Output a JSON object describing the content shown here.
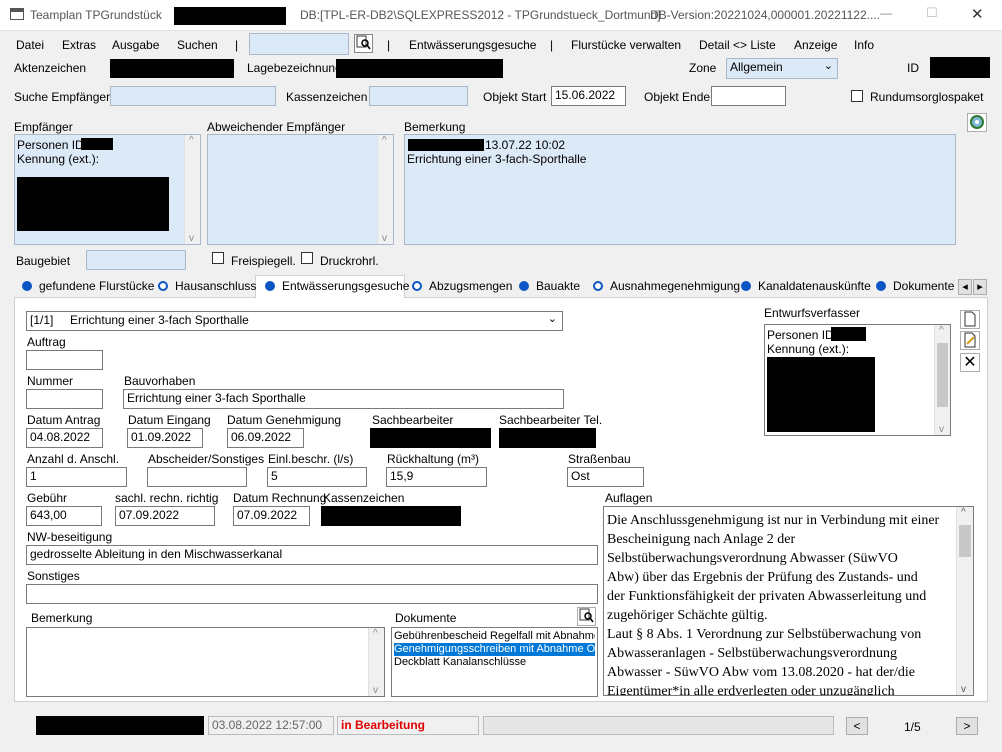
{
  "window": {
    "title": "Teamplan TPGrundstück",
    "db": "DB:[TPL-ER-DB2\\SQLEXPRESS2012 - TPGrundstueck_Dortmund]",
    "db_version": "DB-Version:20221024,000001.20221122....",
    "minimize": "—",
    "maximize": "☐",
    "close": "✕"
  },
  "menu": {
    "datei": "Datei",
    "extras": "Extras",
    "ausgabe": "Ausgabe",
    "suchen": "Suchen",
    "sep": "|",
    "entwaesserung": "Entwässerungsgesuche",
    "flurstuecke": "Flurstücke verwalten",
    "detail": "Detail <> Liste",
    "anzeige": "Anzeige",
    "info": "Info"
  },
  "header": {
    "aktenzeichen_label": "Aktenzeichen",
    "lagebezeichnung_label": "Lagebezeichnung",
    "zone_label": "Zone",
    "zone_value": "Allgemein",
    "id_label": "ID",
    "suche_empfaenger_label": "Suche Empfänger",
    "kassenzeichen_label": "Kassenzeichen",
    "objekt_start_label": "Objekt Start",
    "objekt_start_value": "15.06.2022",
    "objekt_ende_label": "Objekt Ende",
    "rundum_label": "Rundumsorglospaket"
  },
  "empfaenger": {
    "label": "Empfänger",
    "personen_id": "Personen ID:",
    "kennung": "Kennung (ext.):"
  },
  "abweichender_label": "Abweichender Empfänger",
  "bemerkung_top": {
    "label": "Bemerkung",
    "timestamp": "13.07.22 10:02",
    "text": "Errichtung einer 3-fach-Sporthalle"
  },
  "baugebiet_label": "Baugebiet",
  "freispiegel_label": "Freispiegell.",
  "druckrohr_label": "Druckrohrl.",
  "tabs": [
    {
      "label": "gefundene Flurstücke",
      "style": "filled"
    },
    {
      "label": "Hausanschluss",
      "style": "ring"
    },
    {
      "label": "Entwässerungsgesuche",
      "style": "filled"
    },
    {
      "label": "Abzugsmengen",
      "style": "ring"
    },
    {
      "label": "Bauakte",
      "style": "filled"
    },
    {
      "label": "Ausnahmegenehmigung",
      "style": "ring"
    },
    {
      "label": "Kanaldatenauskünfte",
      "style": "filled"
    },
    {
      "label": "Dokumente",
      "style": "filled"
    }
  ],
  "gesuch": {
    "selector": "[1/1]     Errichtung einer 3-fach Sporthalle",
    "auftrag_label": "Auftrag",
    "nummer_label": "Nummer",
    "bauvorhaben_label": "Bauvorhaben",
    "bauvorhaben_value": "Errichtung einer 3-fach Sporthalle",
    "datum_antrag_label": "Datum Antrag",
    "datum_antrag_value": "04.08.2022",
    "datum_eingang_label": "Datum Eingang",
    "datum_eingang_value": "01.09.2022",
    "datum_genehmigung_label": "Datum Genehmigung",
    "datum_genehmigung_value": "06.09.2022",
    "sachbearbeiter_label": "Sachbearbeiter",
    "sachbearbeiter_tel_label": "Sachbearbeiter Tel.",
    "anzahl_label": "Anzahl d. Anschl.",
    "anzahl_value": "1",
    "abscheider_label": "Abscheider/Sonstiges",
    "einl_label": "Einl.beschr. (l/s)",
    "einl_value": "5",
    "rueckhaltung_label": "Rückhaltung (m³)",
    "rueckhaltung_value": "15,9",
    "strassenbau_label": "Straßenbau",
    "strassenbau_value": "Ost",
    "gebuehr_label": "Gebühr",
    "gebuehr_value": "643,00",
    "sachl_label": "sachl. rechn. richtig",
    "sachl_value": "07.09.2022",
    "datum_rechnung_label": "Datum Rechnung",
    "datum_rechnung_value": "07.09.2022",
    "kassenzeichen_label": "Kassenzeichen",
    "nw_label": "NW-beseitigung",
    "nw_value": "gedrosselte Ableitung in den Mischwasserkanal",
    "sonstiges_label": "Sonstiges",
    "bemerkung_label": "Bemerkung",
    "dokumente_label": "Dokumente",
    "dokumente": [
      "Gebührenbescheid Regelfall mit Abnahme",
      "Genehmigungsschreiben mit Abnahme Ost",
      "Deckblatt Kanalanschlüsse"
    ]
  },
  "entwurfsverfasser": {
    "label": "Entwurfsverfasser",
    "personen_id": "Personen ID:",
    "kennung": "Kennung (ext.):"
  },
  "auflagen": {
    "label": "Auflagen",
    "lines": [
      "Die Anschlussgenehmigung ist nur in Verbindung mit einer",
      "Bescheinigung nach Anlage 2 der",
      "Selbstüberwachungsverordnung Abwasser (SüwVO",
      "Abw) über das Ergebnis der Prüfung des Zustands- und",
      "der Funktionsfähigkeit der privaten Abwasserleitung und",
      "zugehöriger Schächte gültig.",
      "Laut § 8 Abs. 1 Verordnung zur Selbstüberwachung von",
      "Abwasseranlagen - Selbstüberwachungsverordnung",
      "Abwasser - SüwVO Abw vom 13.08.2020 - hat der/die",
      "Eigentümer*in alle erdverlegten oder unzugänglich"
    ]
  },
  "statusbar": {
    "timestamp": "03.08.2022 12:57:00",
    "status": "in Bearbeitung",
    "prev": "<",
    "page": "1/5",
    "next": ">"
  }
}
